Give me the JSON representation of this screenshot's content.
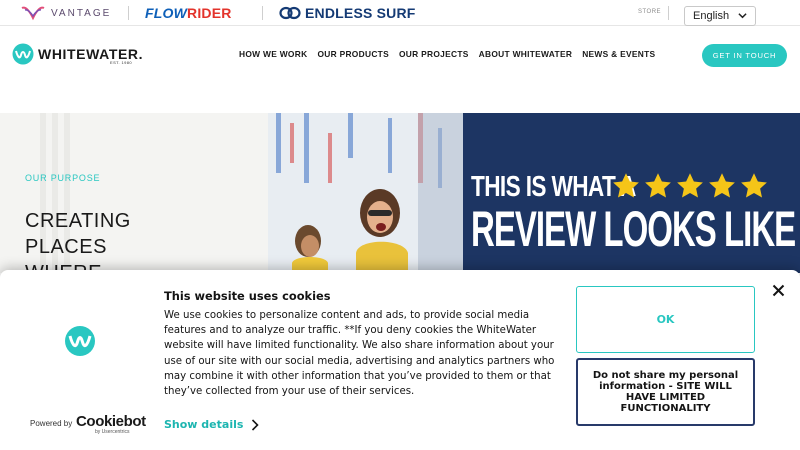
{
  "topbar": {
    "brands": [
      {
        "name": "VANTAGE"
      },
      {
        "name_main": "FLOW",
        "name_accent": "RIDER"
      },
      {
        "name": "ENDLESS SURF"
      }
    ],
    "store_label": "STORE",
    "language": {
      "selected": "English"
    }
  },
  "nav": {
    "logo_name": "WHITEWATER.",
    "logo_est": "EST. 1980",
    "links": [
      "HOW WE WORK",
      "OUR PRODUCTS",
      "OUR PROJECTS",
      "ABOUT WHITEWATER",
      "NEWS & EVENTS"
    ],
    "cta": "GET IN TOUCH"
  },
  "hero": {
    "eyebrow": "OUR PURPOSE",
    "headline_lines": [
      "CREATING",
      "PLACES",
      "WHERE"
    ],
    "banner_line1": "THIS IS WHAT A",
    "banner_line2": "REVIEW LOOKS LIKE",
    "star_count": 5
  },
  "cookie": {
    "title": "This website uses cookies",
    "body": "We use cookies to personalize content and ads, to provide social media features and to analyze our traffic. **If you deny cookies the WhiteWater website will have limited functionality.  We also share information about your use of our site with our social media, advertising and analytics partners who may combine it with other information that you’ve provided to them or that they’ve collected from your use of their services.",
    "show_details": "Show details",
    "ok": "OK",
    "deny": "Do not share my personal information - SITE WILL HAVE LIMITED FUNCTIONALITY",
    "powered_by": "Powered by",
    "provider": "Cookiebot",
    "provider_sub": "by Usercentrics"
  },
  "colors": {
    "accent": "#29c7c1",
    "banner_navy": "#1d3563",
    "star_yellow": "#f5c518",
    "flowrider_blue": "#0d5fb8",
    "endless_navy": "#143a74"
  },
  "icons": [
    "vantage-logo-icon",
    "endless-surf-ring-icon",
    "chevron-down-icon",
    "whitewater-logo-icon",
    "star-icon",
    "chevron-right-icon",
    "close-icon"
  ]
}
